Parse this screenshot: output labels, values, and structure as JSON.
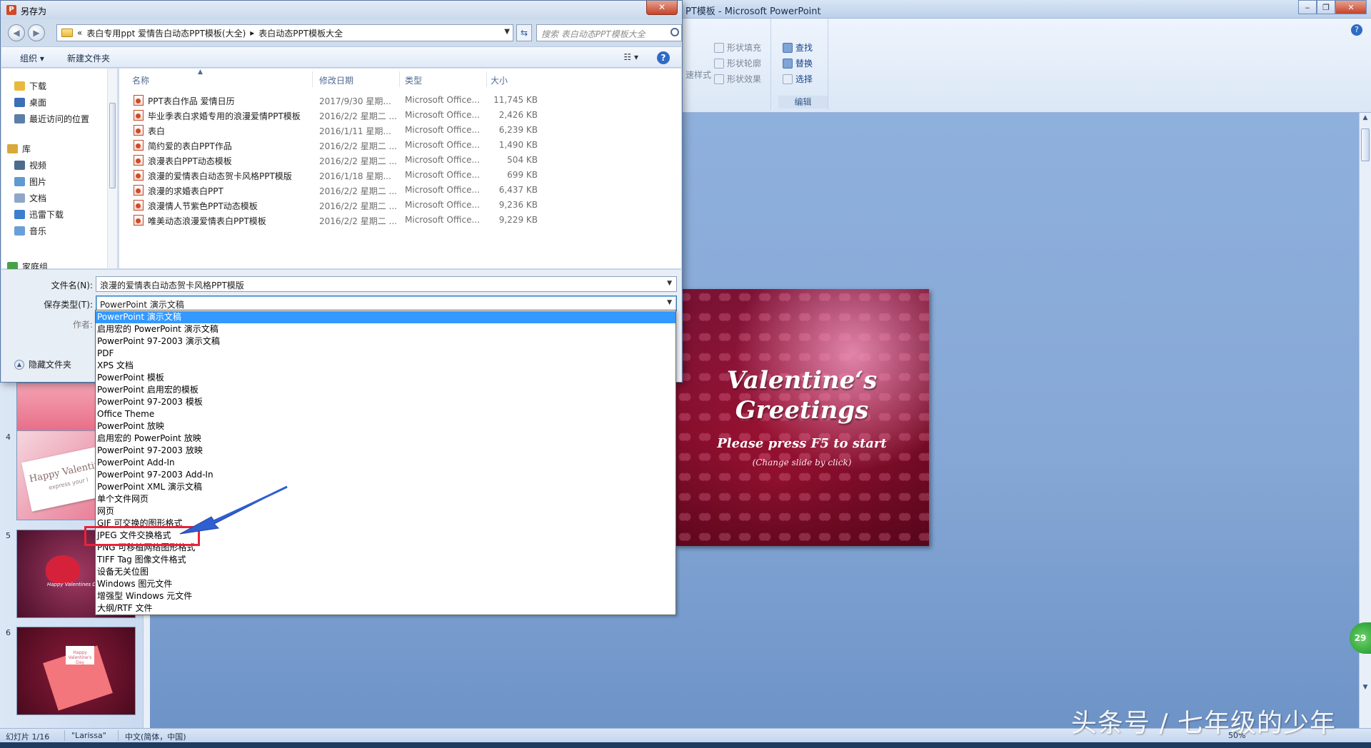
{
  "ppt": {
    "title": "PT模板 - Microsoft PowerPoint",
    "ribbon": {
      "shape_fill": "形状填充",
      "shape_outline": "形状轮廓",
      "shape_effects": "形状效果",
      "quick_styles": "速样式",
      "find": "查找",
      "replace": "替换",
      "select": "选择",
      "edit_group": "编辑"
    },
    "thumbnails": [
      {
        "num": "4",
        "text": "Happy Valentin",
        "sub": "express your l"
      },
      {
        "num": "5",
        "text": "Happy Valentines D"
      },
      {
        "num": "6",
        "text": "Happy Valentine's Day"
      }
    ],
    "slide": {
      "title_line1": "Valentine‘s",
      "title_line2": "Greetings",
      "subtitle": "Please press F5 to start",
      "note": "(Change slide by click)"
    },
    "status": {
      "slide": "幻灯片 1/16",
      "theme": "\"Larissa\"",
      "lang": "中文(简体，中国)",
      "zoom": "50%"
    },
    "zoom_badge": "29"
  },
  "dialog": {
    "title": "另存为",
    "app_icon": "P",
    "path": {
      "prefix": "«",
      "seg1": "表白专用ppt 爱情告白动态PPT模板(大全)",
      "sep": "▸",
      "seg2": "表白动态PPT模板大全"
    },
    "search_placeholder": "搜索 表白动态PPT模板大全",
    "toolbar": {
      "organize": "组织 ▾",
      "new_folder": "新建文件夹"
    },
    "nav": [
      {
        "label": "下载",
        "icon": "download-folder-icon",
        "color": "#e8b93c"
      },
      {
        "label": "桌面",
        "icon": "desktop-icon",
        "color": "#3b6fb6"
      },
      {
        "label": "最近访问的位置",
        "icon": "recent-places-icon",
        "color": "#5c7fa8"
      },
      {
        "label": "库",
        "icon": "library-icon",
        "color": "#d8a93a"
      },
      {
        "label": "视频",
        "icon": "video-library-icon",
        "color": "#4d6b8f"
      },
      {
        "label": "图片",
        "icon": "pictures-library-icon",
        "color": "#5f9bd0"
      },
      {
        "label": "文档",
        "icon": "documents-library-icon",
        "color": "#8ea7c8"
      },
      {
        "label": "迅雷下载",
        "icon": "thunder-folder-icon",
        "color": "#3c7fd0"
      },
      {
        "label": "音乐",
        "icon": "music-library-icon",
        "color": "#6aa0d8"
      },
      {
        "label": "家庭组",
        "icon": "homegroup-icon",
        "color": "#4aa04a"
      }
    ],
    "columns": {
      "name": "名称",
      "date": "修改日期",
      "type": "类型",
      "size": "大小"
    },
    "files": [
      {
        "name": "PPT表白作品 爱情日历",
        "date": "2017/9/30 星期...",
        "type": "Microsoft Office...",
        "size": "11,745 KB"
      },
      {
        "name": "毕业季表白求婚专用的浪漫爱情PPT模板",
        "date": "2016/2/2 星期二 ...",
        "type": "Microsoft Office...",
        "size": "2,426 KB"
      },
      {
        "name": "表白",
        "date": "2016/1/11 星期...",
        "type": "Microsoft Office...",
        "size": "6,239 KB"
      },
      {
        "name": "简约爱的表白PPT作品",
        "date": "2016/2/2 星期二 ...",
        "type": "Microsoft Office...",
        "size": "1,490 KB"
      },
      {
        "name": "浪漫表白PPT动态模板",
        "date": "2016/2/2 星期二 ...",
        "type": "Microsoft Office...",
        "size": "504 KB"
      },
      {
        "name": "浪漫的爱情表白动态贺卡风格PPT模版",
        "date": "2016/1/18 星期...",
        "type": "Microsoft Office...",
        "size": "699 KB"
      },
      {
        "name": "浪漫的求婚表白PPT",
        "date": "2016/2/2 星期二 ...",
        "type": "Microsoft Office...",
        "size": "6,437 KB"
      },
      {
        "name": "浪漫情人节紫色PPT动态模板",
        "date": "2016/2/2 星期二 ...",
        "type": "Microsoft Office...",
        "size": "9,236 KB"
      },
      {
        "name": "唯美动态浪漫爱情表白PPT模板",
        "date": "2016/2/2 星期二 ...",
        "type": "Microsoft Office...",
        "size": "9,229 KB"
      }
    ],
    "form": {
      "filename_label": "文件名(N):",
      "filename_value": "浪漫的爱情表白动态贺卡风格PPT模版",
      "savetype_label": "保存类型(T):",
      "savetype_value": "PowerPoint 演示文稿",
      "author_label": "作者:",
      "hide_folders": "隐藏文件夹"
    },
    "save_types": [
      "PowerPoint 演示文稿",
      "启用宏的 PowerPoint 演示文稿",
      "PowerPoint 97-2003 演示文稿",
      "PDF",
      "XPS 文档",
      "PowerPoint 模板",
      "PowerPoint 启用宏的模板",
      "PowerPoint 97-2003 模板",
      "Office Theme",
      "PowerPoint 放映",
      "启用宏的 PowerPoint 放映",
      "PowerPoint 97-2003 放映",
      "PowerPoint Add-In",
      "PowerPoint 97-2003 Add-In",
      "PowerPoint XML 演示文稿",
      "单个文件网页",
      "网页",
      "GIF 可交换的图形格式",
      "JPEG 文件交换格式",
      "PNG 可移植网络图形格式",
      "TIFF Tag 图像文件格式",
      "设备无关位图",
      "Windows 图元文件",
      "增强型 Windows 元文件",
      "大纲/RTF 文件"
    ],
    "selected_index": 0,
    "highlighted_index": 18
  },
  "watermark": "头条号 / 七年级的少年",
  "colors": {
    "selection": "#3399ff",
    "annotation_red": "#e8233a",
    "annotation_arrow": "#2f5fd0"
  }
}
